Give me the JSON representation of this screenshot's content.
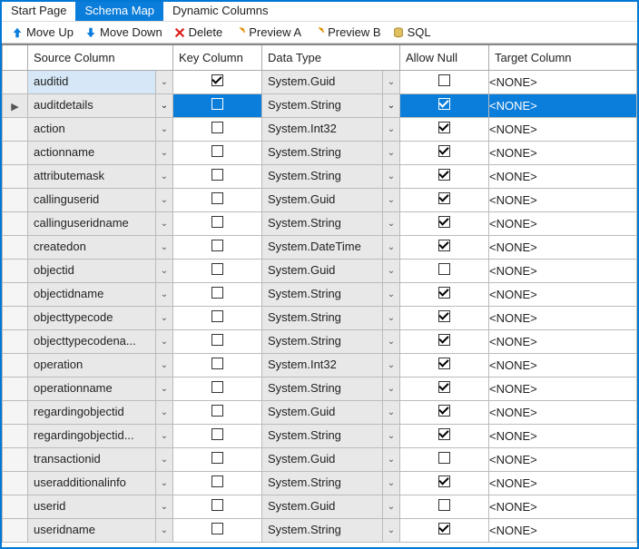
{
  "tabs": [
    {
      "label": "Start Page",
      "active": false
    },
    {
      "label": "Schema Map",
      "active": true
    },
    {
      "label": "Dynamic Columns",
      "active": false
    }
  ],
  "toolbar": {
    "move_up": "Move Up",
    "move_down": "Move Down",
    "delete": "Delete",
    "preview_a": "Preview A",
    "preview_b": "Preview B",
    "sql": "SQL"
  },
  "columns": {
    "source": "Source Column",
    "key": "Key Column",
    "datatype": "Data Type",
    "allownull": "Allow Null",
    "target": "Target Column"
  },
  "rows": [
    {
      "source": "auditid",
      "key": true,
      "datatype": "System.Guid",
      "allownull": false,
      "target": "<NONE>",
      "first": true
    },
    {
      "source": "auditdetails",
      "key": false,
      "datatype": "System.String",
      "allownull": true,
      "target": "<NONE>",
      "selected": true
    },
    {
      "source": "action",
      "key": false,
      "datatype": "System.Int32",
      "allownull": true,
      "target": "<NONE>"
    },
    {
      "source": "actionname",
      "key": false,
      "datatype": "System.String",
      "allownull": true,
      "target": "<NONE>"
    },
    {
      "source": "attributemask",
      "key": false,
      "datatype": "System.String",
      "allownull": true,
      "target": "<NONE>"
    },
    {
      "source": "callinguserid",
      "key": false,
      "datatype": "System.Guid",
      "allownull": true,
      "target": "<NONE>"
    },
    {
      "source": "callinguseridname",
      "key": false,
      "datatype": "System.String",
      "allownull": true,
      "target": "<NONE>"
    },
    {
      "source": "createdon",
      "key": false,
      "datatype": "System.DateTime",
      "allownull": true,
      "target": "<NONE>"
    },
    {
      "source": "objectid",
      "key": false,
      "datatype": "System.Guid",
      "allownull": false,
      "target": "<NONE>"
    },
    {
      "source": "objectidname",
      "key": false,
      "datatype": "System.String",
      "allownull": true,
      "target": "<NONE>"
    },
    {
      "source": "objecttypecode",
      "key": false,
      "datatype": "System.String",
      "allownull": true,
      "target": "<NONE>"
    },
    {
      "source": "objecttypecodena...",
      "key": false,
      "datatype": "System.String",
      "allownull": true,
      "target": "<NONE>"
    },
    {
      "source": "operation",
      "key": false,
      "datatype": "System.Int32",
      "allownull": true,
      "target": "<NONE>"
    },
    {
      "source": "operationname",
      "key": false,
      "datatype": "System.String",
      "allownull": true,
      "target": "<NONE>"
    },
    {
      "source": "regardingobjectid",
      "key": false,
      "datatype": "System.Guid",
      "allownull": true,
      "target": "<NONE>"
    },
    {
      "source": "regardingobjectid...",
      "key": false,
      "datatype": "System.String",
      "allownull": true,
      "target": "<NONE>"
    },
    {
      "source": "transactionid",
      "key": false,
      "datatype": "System.Guid",
      "allownull": false,
      "target": "<NONE>"
    },
    {
      "source": "useradditionalinfo",
      "key": false,
      "datatype": "System.String",
      "allownull": true,
      "target": "<NONE>"
    },
    {
      "source": "userid",
      "key": false,
      "datatype": "System.Guid",
      "allownull": false,
      "target": "<NONE>"
    },
    {
      "source": "useridname",
      "key": false,
      "datatype": "System.String",
      "allownull": true,
      "target": "<NONE>"
    }
  ]
}
